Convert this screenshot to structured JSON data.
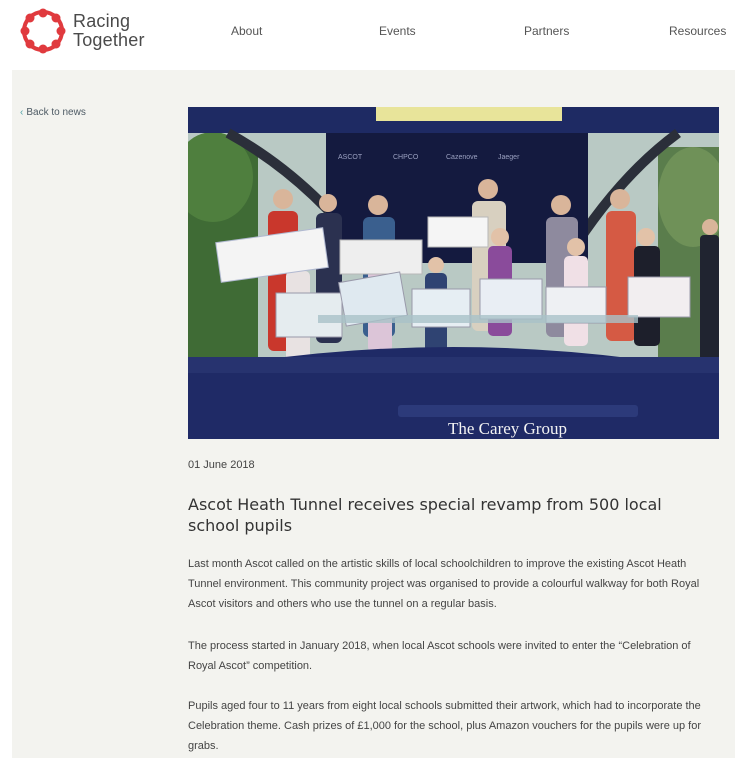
{
  "logo": {
    "line1": "Racing",
    "line2": "Together"
  },
  "nav": [
    {
      "label": "About"
    },
    {
      "label": "Events"
    },
    {
      "label": "Partners"
    },
    {
      "label": "Resources"
    }
  ],
  "back_link": {
    "label": "Back to news"
  },
  "hero": {
    "banner_text": "The Carey Group",
    "backdrop_logos": [
      "ASCOT",
      "CHPCO",
      "Cazenove",
      "Jaeger"
    ]
  },
  "article": {
    "date": "01 June 2018",
    "title": "Ascot Heath Tunnel receives special revamp from 500 local school pupils",
    "paragraphs": [
      "Last month Ascot called on the artistic skills of local schoolchildren to improve the existing Ascot Heath Tunnel environment. This community project was organised to provide a colourful walkway for both Royal Ascot visitors and others who use the tunnel on a regular basis.",
      "The process started in January 2018, when local Ascot schools were invited to enter the “Celebration of Royal Ascot” competition.",
      "Pupils aged four to 11 years from eight local schools submitted their artwork, which had to incorporate the Celebration theme. Cash prizes of £1,000 for the school, plus Amazon vouchers for the pupils were up for grabs."
    ]
  },
  "colors": {
    "brand_red": "#e03a3e",
    "content_bg": "#f3f3ef",
    "podium_navy": "#1f2a66",
    "back_chevron": "#4fa3a8"
  },
  "icons": {
    "back": "chevron-left-icon"
  }
}
